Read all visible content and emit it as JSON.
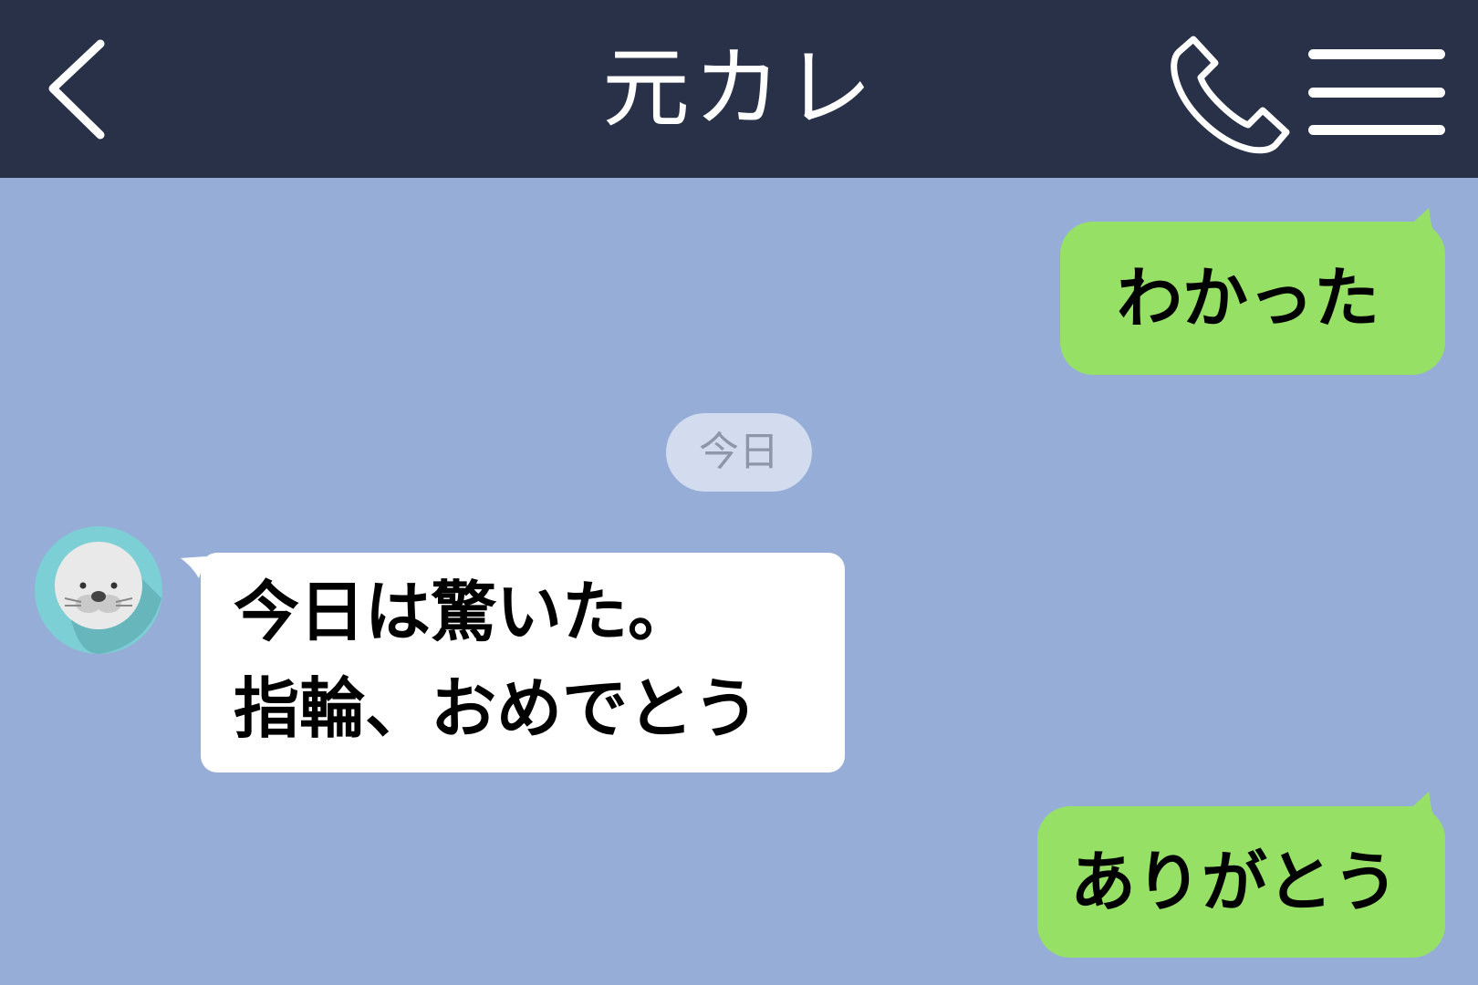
{
  "header": {
    "title": "元カレ",
    "back_icon": "chevron-left-icon",
    "call_icon": "phone-icon",
    "menu_icon": "hamburger-menu-icon"
  },
  "colors": {
    "header_bg": "#283148",
    "chat_bg": "#96aed7",
    "sent_bubble": "#96e066",
    "received_bubble": "#ffffff",
    "date_pill_bg": "#d2dcee"
  },
  "messages": [
    {
      "side": "sent",
      "text": "わかった"
    },
    {
      "side": "received",
      "line1": "今日は驚いた。",
      "line2": "指輪、おめでとう",
      "avatar_icon": "seal-avatar-icon"
    },
    {
      "side": "sent",
      "text": "ありがとう"
    }
  ],
  "date_separator": "今日"
}
